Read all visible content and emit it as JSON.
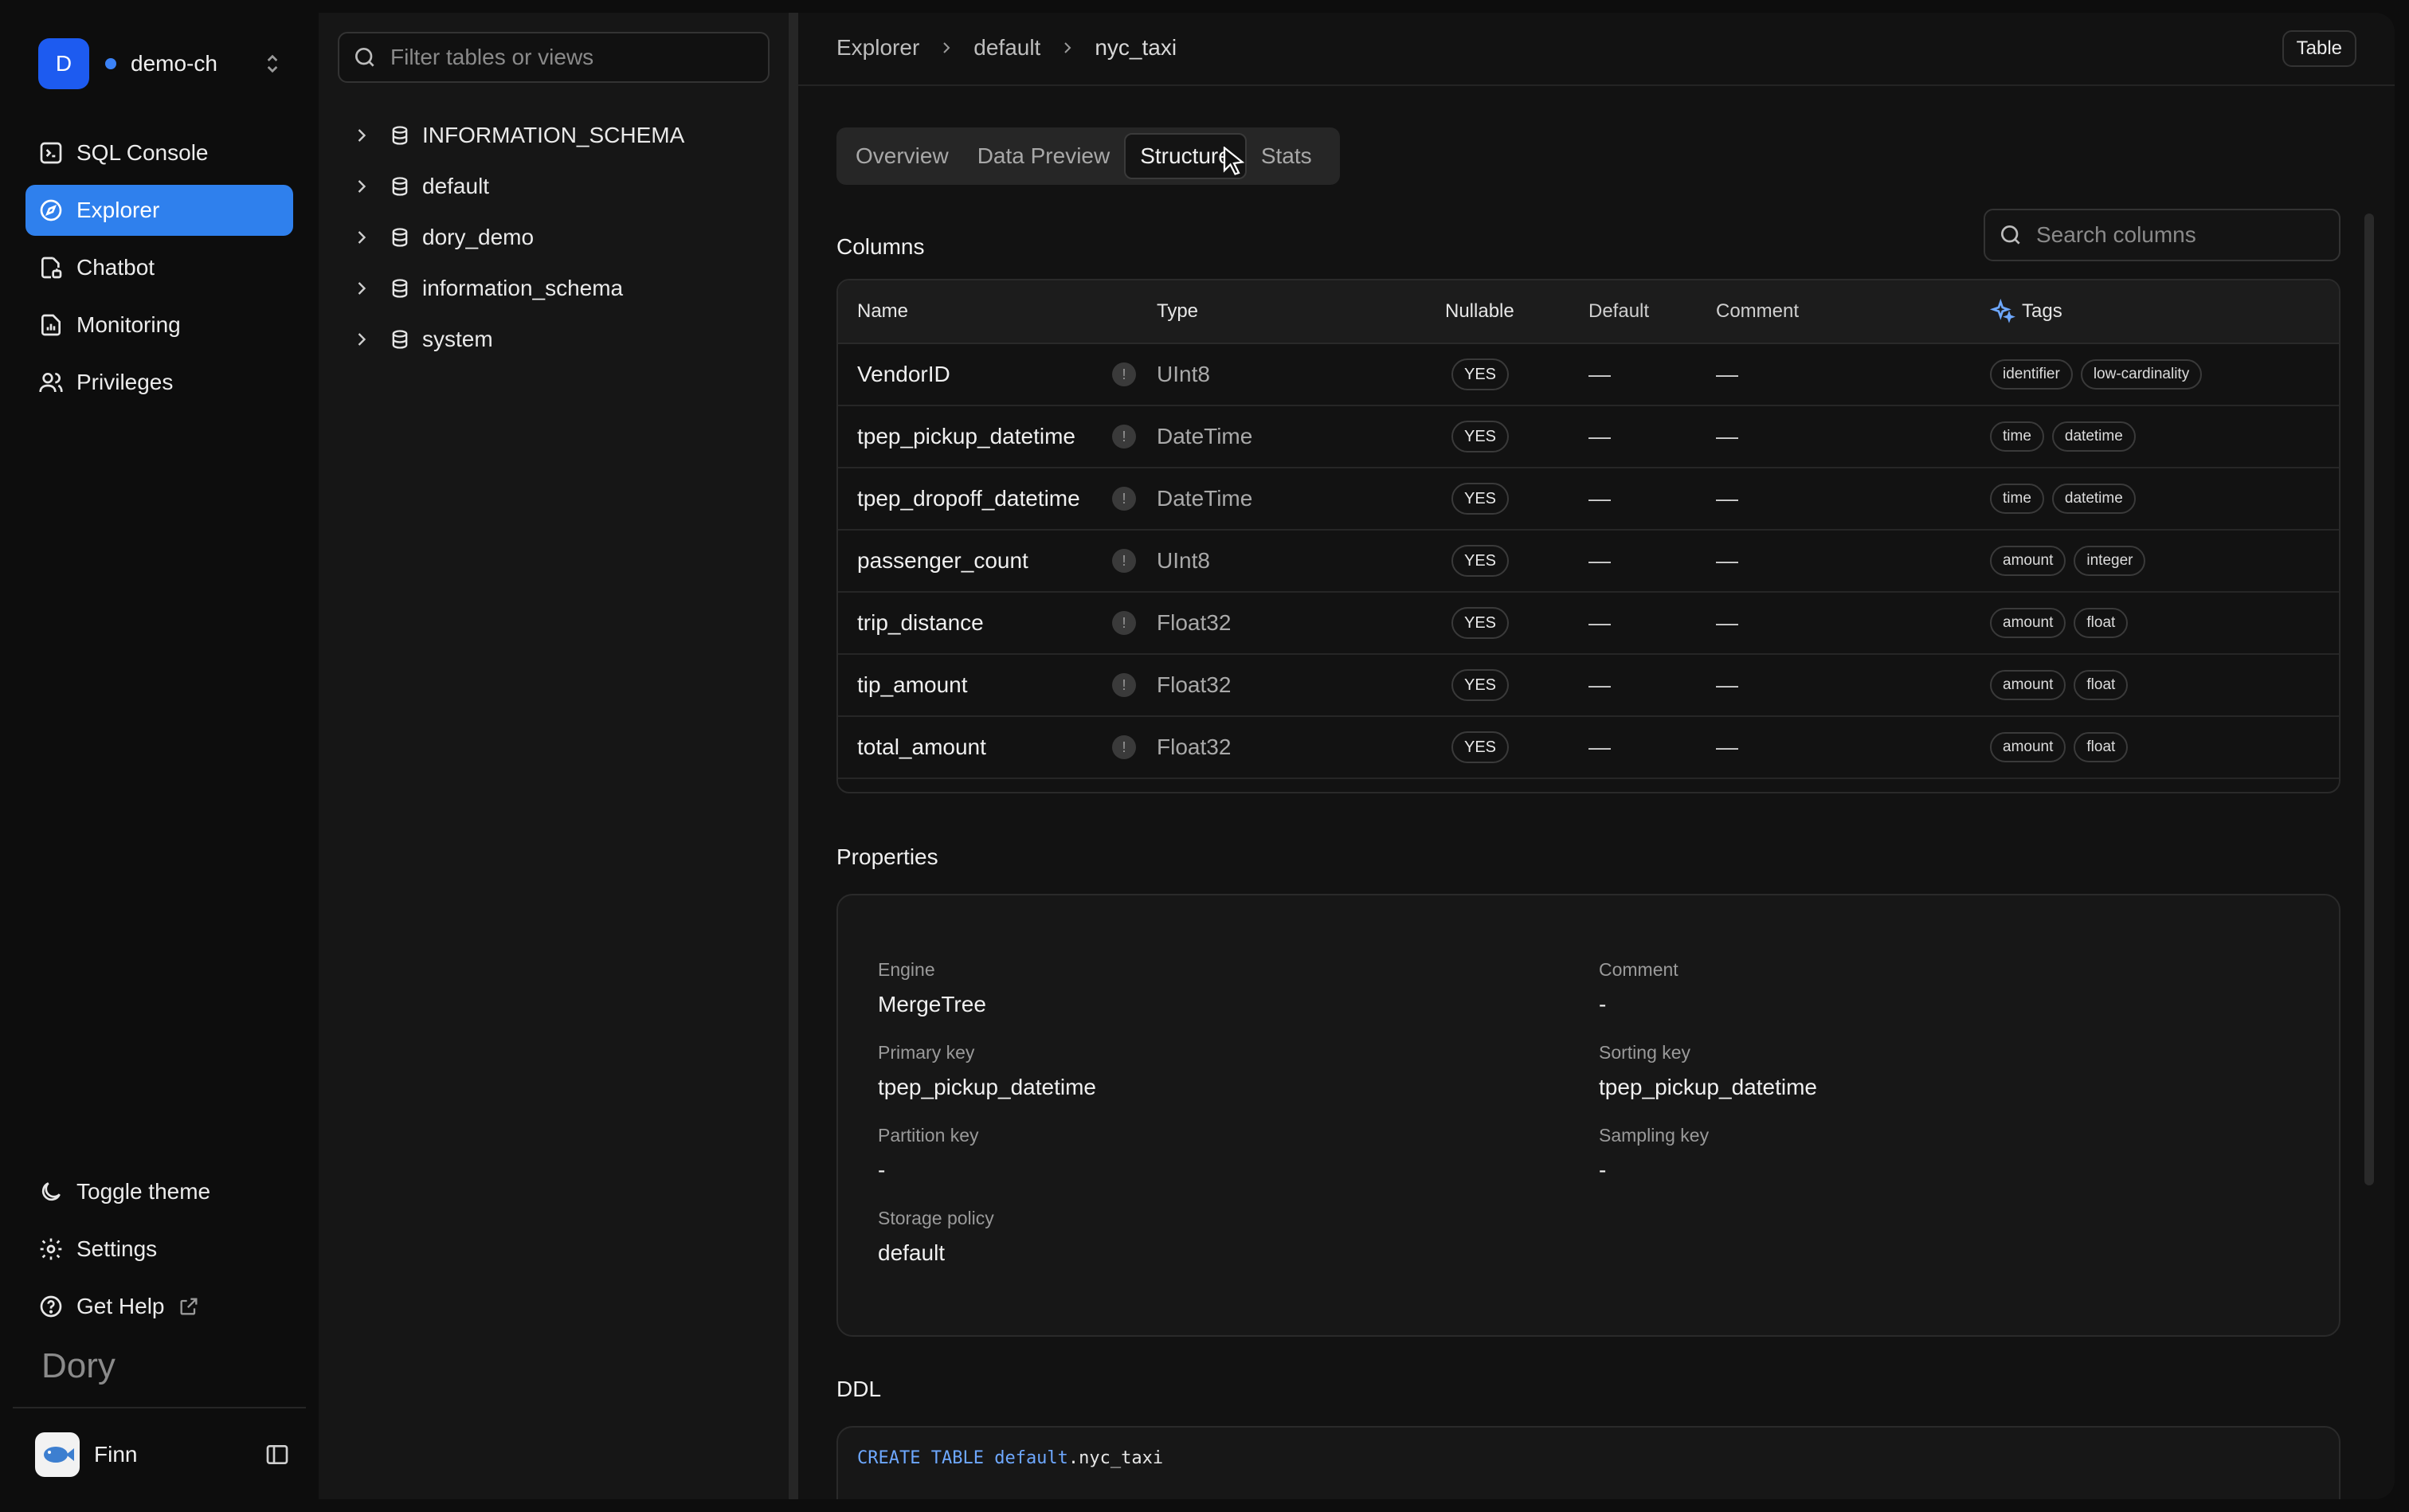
{
  "workspace": {
    "initial": "D",
    "name": "demo-ch"
  },
  "nav": [
    {
      "label": "SQL Console",
      "icon": "sql-console-icon"
    },
    {
      "label": "Explorer",
      "icon": "compass-icon",
      "active": true
    },
    {
      "label": "Chatbot",
      "icon": "chatbot-icon"
    },
    {
      "label": "Monitoring",
      "icon": "monitoring-icon"
    },
    {
      "label": "Privileges",
      "icon": "users-icon"
    }
  ],
  "nav_bottom": [
    {
      "label": "Toggle theme",
      "icon": "moon-icon"
    },
    {
      "label": "Settings",
      "icon": "gear-icon"
    },
    {
      "label": "Get Help",
      "icon": "help-circle-icon"
    }
  ],
  "brand": "Dory",
  "user": {
    "name": "Finn"
  },
  "tree": {
    "filter_placeholder": "Filter tables or views",
    "items": [
      "INFORMATION_SCHEMA",
      "default",
      "dory_demo",
      "information_schema",
      "system"
    ]
  },
  "breadcrumb": [
    "Explorer",
    "default",
    "nyc_taxi"
  ],
  "object_type_badge": "Table",
  "tabs": [
    "Overview",
    "Data Preview",
    "Structure",
    "Stats"
  ],
  "active_tab": "Structure",
  "columns_section": {
    "title": "Columns",
    "search_placeholder": "Search columns",
    "headers": [
      "Name",
      "Type",
      "Nullable",
      "Default",
      "Comment",
      "Tags"
    ],
    "rows": [
      {
        "name": "VendorID",
        "type": "UInt8",
        "nullable": "YES",
        "default": "—",
        "comment": "—",
        "tags": [
          "identifier",
          "low-cardinality"
        ]
      },
      {
        "name": "tpep_pickup_datetime",
        "type": "DateTime",
        "nullable": "YES",
        "default": "—",
        "comment": "—",
        "tags": [
          "time",
          "datetime"
        ]
      },
      {
        "name": "tpep_dropoff_datetime",
        "type": "DateTime",
        "nullable": "YES",
        "default": "—",
        "comment": "—",
        "tags": [
          "time",
          "datetime"
        ]
      },
      {
        "name": "passenger_count",
        "type": "UInt8",
        "nullable": "YES",
        "default": "—",
        "comment": "—",
        "tags": [
          "amount",
          "integer"
        ]
      },
      {
        "name": "trip_distance",
        "type": "Float32",
        "nullable": "YES",
        "default": "—",
        "comment": "—",
        "tags": [
          "amount",
          "float"
        ]
      },
      {
        "name": "tip_amount",
        "type": "Float32",
        "nullable": "YES",
        "default": "—",
        "comment": "—",
        "tags": [
          "amount",
          "float"
        ]
      },
      {
        "name": "total_amount",
        "type": "Float32",
        "nullable": "YES",
        "default": "—",
        "comment": "—",
        "tags": [
          "amount",
          "float"
        ]
      }
    ]
  },
  "properties": {
    "title": "Properties",
    "items": {
      "engine": {
        "label": "Engine",
        "value": "MergeTree"
      },
      "comment": {
        "label": "Comment",
        "value": "-"
      },
      "primary_key": {
        "label": "Primary key",
        "value": "tpep_pickup_datetime"
      },
      "sorting_key": {
        "label": "Sorting key",
        "value": "tpep_pickup_datetime"
      },
      "partition_key": {
        "label": "Partition key",
        "value": "-"
      },
      "sampling_key": {
        "label": "Sampling key",
        "value": "-"
      },
      "storage_policy": {
        "label": "Storage policy",
        "value": "default"
      }
    }
  },
  "ddl": {
    "title": "DDL",
    "kw1": "CREATE TABLE",
    "kw2": "default",
    "rest": ".nyc_taxi"
  },
  "colors": {
    "accent": "#2f80ed",
    "keyword": "#6ea8ff",
    "background": "#0d0d0d"
  }
}
